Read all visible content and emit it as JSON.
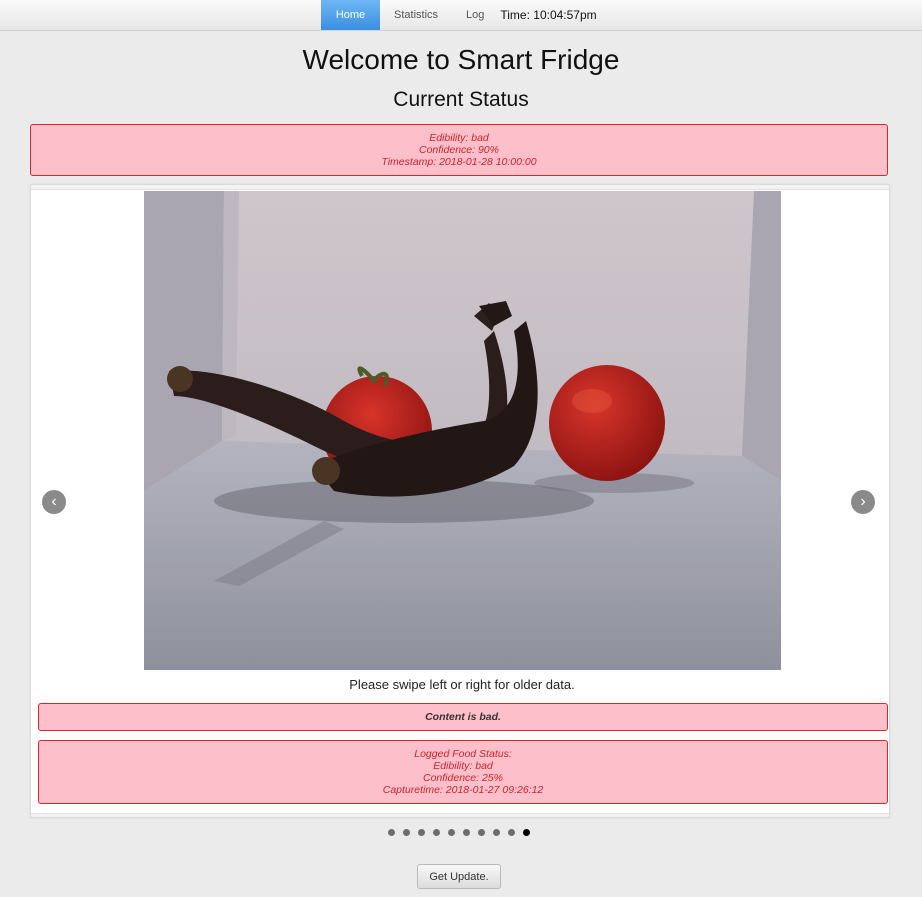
{
  "nav": {
    "tabs": [
      {
        "label": "Home",
        "active": true
      },
      {
        "label": "Statistics",
        "active": false
      },
      {
        "label": "Log",
        "active": false
      }
    ],
    "time": "Time: 10:04:57pm"
  },
  "page": {
    "title": "Welcome to Smart Fridge",
    "section_title": "Current Status"
  },
  "current_status": {
    "edibility": "Edibility: bad",
    "confidence": "Confidence: 90%",
    "timestamp": "Timestamp: 2018-01-28 10:00:00"
  },
  "carousel": {
    "prev_icon": "chevron-left-icon",
    "next_icon": "chevron-right-icon",
    "swipe_hint": "Please swipe left or right for older data.",
    "verdict": "Content is bad.",
    "logged": {
      "heading": "Logged Food Status:",
      "edibility": "Edibility: bad",
      "confidence": "Confidence: 25%",
      "capturetime": "Capturetime: 2018-01-27 09:26:12"
    },
    "slide_count": 10,
    "active_slide": 10
  },
  "buttons": {
    "update": "Get Update."
  },
  "colors": {
    "alert_bg": "#fdbfc9",
    "alert_border": "#d62a2a",
    "alert_text": "#c8252f",
    "nav_active": "#3a8fe0"
  }
}
